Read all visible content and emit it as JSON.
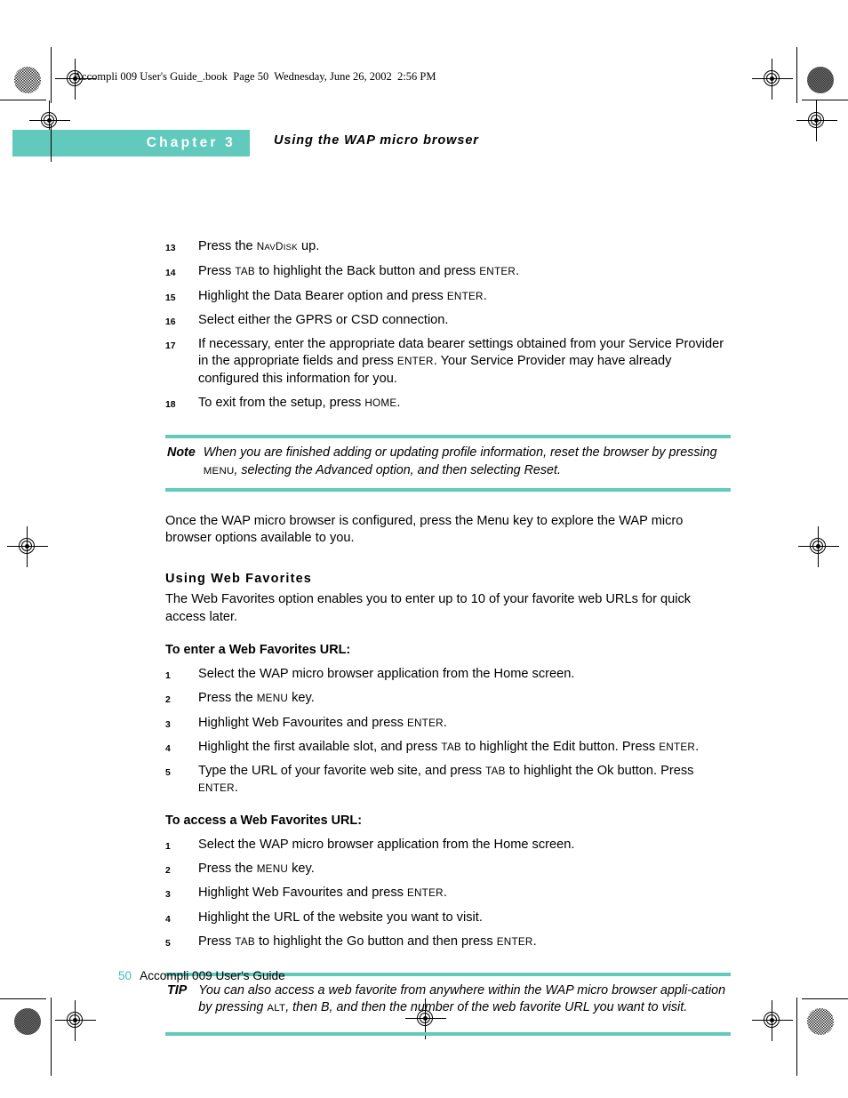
{
  "book_header": "Accompli 009 User's Guide_.book  Page 50  Wednesday, June 26, 2002  2:56 PM",
  "chapter": {
    "label": "Chapter 3",
    "subject": "Using the WAP micro browser"
  },
  "colors": {
    "teal": "#62c9bd",
    "page_number_teal": "#3cbfb0"
  },
  "continued_steps": [
    {
      "num": "13",
      "text_before": "Press the ",
      "sc1": "N",
      "text_mid": "",
      "sc_parts": [
        "N",
        "AV",
        "D",
        "ISK"
      ],
      "text_after": " up.",
      "full": "Press the NAVDISK up."
    },
    {
      "num": "14",
      "full": "Press TAB to highlight the Back button and press ENTER."
    },
    {
      "num": "15",
      "full": "Highlight the Data Bearer option and press ENTER."
    },
    {
      "num": "16",
      "full": "Select either the GPRS or CSD connection."
    },
    {
      "num": "17",
      "full": "If necessary, enter the appropriate data bearer settings obtained from your Service Provider in the appropriate fields and press ENTER. Your Service Provider may have already configured this information for you."
    },
    {
      "num": "18",
      "full": "To exit from the setup, press HOME."
    }
  ],
  "note": {
    "label": "Note",
    "text_part1": "When you are finished adding or updating profile information, reset the browser by pressing ",
    "key": "MENU",
    "text_part2": ", selecting the Advanced option, and then selecting Reset."
  },
  "body_paragraph": "Once the WAP micro browser is configured, press the Menu key to explore the WAP micro browser options available to you.",
  "section": {
    "heading": "Using Web Favorites",
    "intro": "The Web Favorites option enables you to enter up to 10 of your favorite web URLs for quick access later."
  },
  "enter_procedure": {
    "heading": "To enter a Web Favorites URL:",
    "steps": [
      {
        "num": "1",
        "full": "Select the WAP micro browser application from the Home screen."
      },
      {
        "num": "2",
        "full": "Press the MENU key."
      },
      {
        "num": "3",
        "full": "Highlight Web Favourites and press ENTER."
      },
      {
        "num": "4",
        "full": "Highlight the first available slot, and press TAB to highlight the Edit button. Press ENTER."
      },
      {
        "num": "5",
        "full": "Type the URL of your favorite web site, and press TAB to highlight the Ok button. Press ENTER."
      }
    ]
  },
  "access_procedure": {
    "heading": "To access a Web Favorites URL:",
    "steps": [
      {
        "num": "1",
        "full": "Select the WAP micro browser application from the Home screen."
      },
      {
        "num": "2",
        "full": "Press the MENU key."
      },
      {
        "num": "3",
        "full": "Highlight Web Favourites and press ENTER."
      },
      {
        "num": "4",
        "full": "Highlight the URL of the website you want to visit."
      },
      {
        "num": "5",
        "full": "Press TAB to highlight the Go button and then press ENTER."
      }
    ]
  },
  "tip": {
    "label": "TIP",
    "text_part1": "You can also access a web favorite from anywhere within the WAP micro browser application by pressing ",
    "key": "ALT",
    "text_part2": ", then B, and then the number of the web favorite URL you want to visit."
  },
  "footer": {
    "page_number": "50",
    "title": "Accompli 009 User's Guide"
  }
}
